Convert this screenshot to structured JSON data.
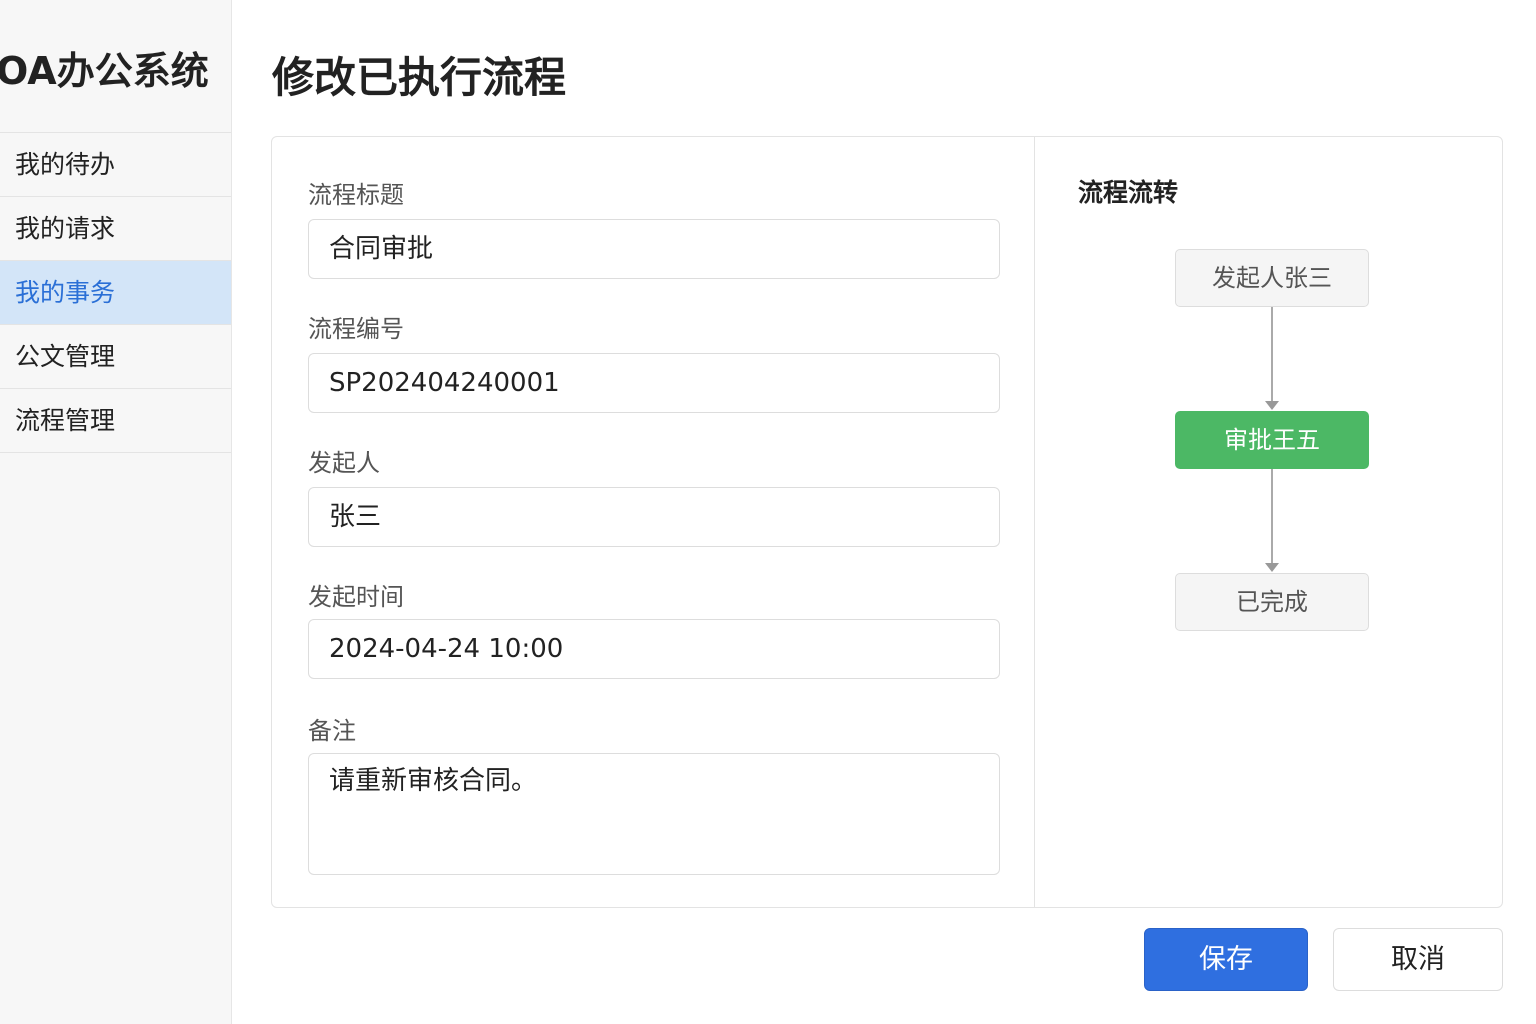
{
  "app_title": "OA办公系统",
  "sidebar": {
    "items": [
      {
        "label": "我的待办"
      },
      {
        "label": "我的请求"
      },
      {
        "label": "我的事务"
      },
      {
        "label": "公文管理"
      },
      {
        "label": "流程管理"
      }
    ],
    "active_index": 2
  },
  "page_title": "修改已执行流程",
  "form": {
    "title_label": "流程标题",
    "title_value": "合同审批",
    "number_label": "流程编号",
    "number_value": "SP202404240001",
    "initiator_label": "发起人",
    "initiator_value": "张三",
    "time_label": "发起时间",
    "time_value": "2024-04-24 10:00",
    "remark_label": "备注",
    "remark_value": "请重新审核合同。"
  },
  "flow": {
    "title": "流程流转",
    "nodes": [
      {
        "label": "发起人张三"
      },
      {
        "label": "审批王五"
      },
      {
        "label": "已完成"
      }
    ],
    "colors": {
      "current": "#4cb865"
    }
  },
  "buttons": {
    "save": "保存",
    "cancel": "取消"
  }
}
